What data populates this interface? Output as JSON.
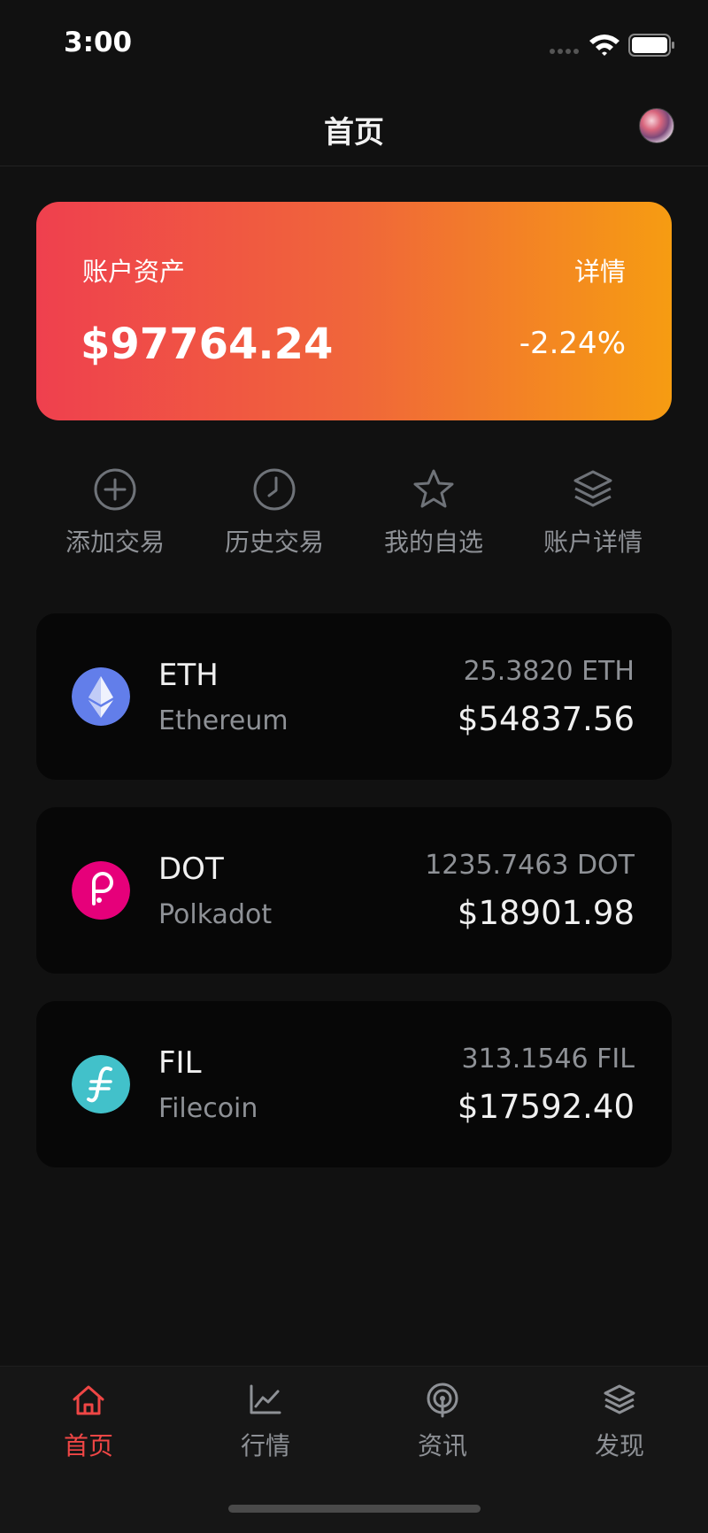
{
  "status_bar": {
    "time": "3:00"
  },
  "nav": {
    "title": "首页"
  },
  "asset_card": {
    "label": "账户资产",
    "detail_link": "详情",
    "total_value": "$97764.24",
    "change": "-2.24%",
    "gradient_colors": [
      "#ef404e",
      "#f69c12"
    ]
  },
  "quick_actions": [
    {
      "label": "添加交易",
      "icon": "add-circle-icon"
    },
    {
      "label": "历史交易",
      "icon": "clock-icon"
    },
    {
      "label": "我的自选",
      "icon": "star-icon"
    },
    {
      "label": "账户详情",
      "icon": "layers-icon"
    }
  ],
  "holdings": [
    {
      "symbol": "ETH",
      "name": "Ethereum",
      "amount": "25.3820 ETH",
      "value": "$54837.56",
      "logo": "ethereum-logo-icon",
      "color": "#627eea"
    },
    {
      "symbol": "DOT",
      "name": "Polkadot",
      "amount": "1235.7463 DOT",
      "value": "$18901.98",
      "logo": "polkadot-logo-icon",
      "color": "#e6007a"
    },
    {
      "symbol": "FIL",
      "name": "Filecoin",
      "amount": "313.1546 FIL",
      "value": "$17592.40",
      "logo": "filecoin-logo-icon",
      "color": "#42c1ca"
    }
  ],
  "tab_bar": {
    "active_color": "#ef4645",
    "inactive_color": "#8e9196",
    "tabs": [
      {
        "label": "首页",
        "icon": "home-icon",
        "active": true
      },
      {
        "label": "行情",
        "icon": "line-chart-icon",
        "active": false
      },
      {
        "label": "资讯",
        "icon": "broadcast-icon",
        "active": false
      },
      {
        "label": "发现",
        "icon": "layers-icon",
        "active": false
      }
    ]
  }
}
